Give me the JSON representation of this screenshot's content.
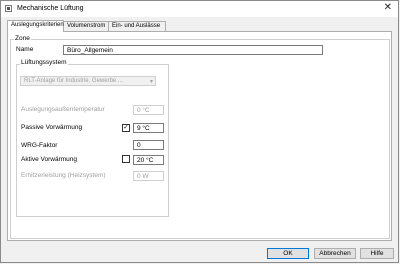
{
  "window": {
    "title": "Mechanische Lüftung",
    "close_glyph": "✕"
  },
  "tabs": [
    {
      "label": "Auslegungskriterien"
    },
    {
      "label": "Volumenstrom"
    },
    {
      "label": "Ein- und Auslässe"
    }
  ],
  "zone": {
    "caption": "Zone",
    "name_label": "Name",
    "name_value": "Büro_Allgemein"
  },
  "luftungssystem": {
    "caption": "Lüftungssystem",
    "combo_value": "RLT-Anlage für Industrie, Gewerbe ...",
    "combo_arrow": "▾",
    "rows": {
      "auslegung": {
        "label": "Auslegungsaußentemperatur",
        "value": "0 °C"
      },
      "passive": {
        "label": "Passive Vorwärmung",
        "value": "9 °C",
        "checked": true,
        "check_glyph": "✓"
      },
      "wrg": {
        "label": "WRG-Faktor",
        "value": "0"
      },
      "aktive": {
        "label": "Aktive Vorwärmung",
        "value": "20 °C",
        "checked": false
      },
      "erhitzer": {
        "label": "Erhitzerleistung (Heizsystem)",
        "value": "0 W"
      }
    }
  },
  "buttons": {
    "ok": "OK",
    "cancel": "Abbrechen",
    "help": "Hilfe"
  }
}
